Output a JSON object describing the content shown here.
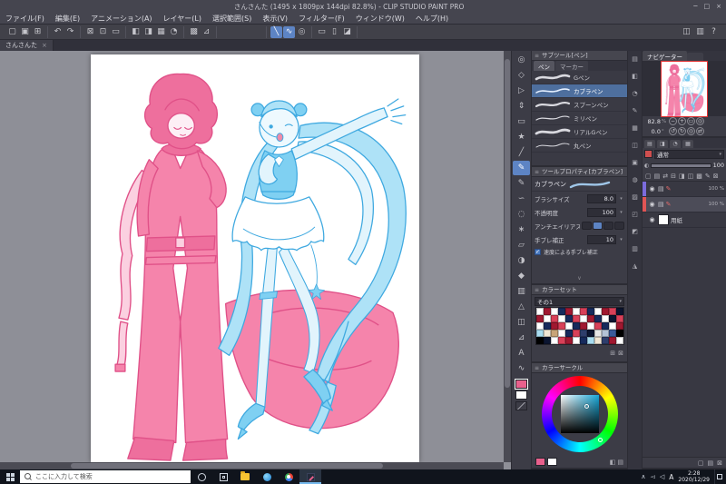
{
  "titlebar": {
    "title": "さんさんた (1495 x 1809px 144dpi 82.8%) - CLIP STUDIO PAINT PRO",
    "controls": [
      "─",
      "□",
      "×"
    ]
  },
  "icons": {
    "check": "✓",
    "caret_down": "▾",
    "close": "×",
    "menu": "≡",
    "collapse": "∨",
    "eye": "◉",
    "folder": "▤",
    "pen": "✎"
  },
  "menubar": {
    "items": [
      "ファイル(F)",
      "編集(E)",
      "アニメーション(A)",
      "レイヤー(L)",
      "選択範囲(S)",
      "表示(V)",
      "フィルター(F)",
      "ウィンドウ(W)",
      "ヘルプ(H)"
    ]
  },
  "toolbar": {
    "groups": [
      {
        "icons": [
          {
            "name": "new-file-icon",
            "glyph": "▢"
          },
          {
            "name": "open-file-icon",
            "glyph": "▣"
          },
          {
            "name": "save-file-icon",
            "glyph": "⊞"
          }
        ]
      },
      {
        "icons": [
          {
            "name": "undo-icon",
            "glyph": "↶"
          },
          {
            "name": "redo-icon",
            "glyph": "↷"
          }
        ]
      },
      {
        "icons": [
          {
            "name": "cut-icon",
            "glyph": "⊠"
          },
          {
            "name": "copy-icon",
            "glyph": "⊡"
          },
          {
            "name": "paste-icon",
            "glyph": "▭"
          }
        ]
      },
      {
        "icons": [
          {
            "name": "zoom-in-icon",
            "glyph": "◧"
          },
          {
            "name": "zoom-out-icon",
            "glyph": "◨"
          },
          {
            "name": "fit-to-screen-icon",
            "glyph": "▦"
          },
          {
            "name": "rotate-view-icon",
            "glyph": "◔"
          }
        ]
      },
      {
        "icons": [
          {
            "name": "grid-icon",
            "glyph": "▩"
          },
          {
            "name": "ruler-toggle-icon",
            "glyph": "⊿"
          }
        ]
      },
      {
        "icons": [
          {
            "name": "snap-to-ruler-icon",
            "glyph": "╲",
            "selected": true
          },
          {
            "name": "snap-to-special-ruler-icon",
            "glyph": "∿",
            "selected": true
          },
          {
            "name": "snap-to-grid-icon",
            "glyph": "◎"
          }
        ]
      },
      {
        "icons": [
          {
            "name": "select-area-icon",
            "glyph": "▭"
          },
          {
            "name": "deselect-icon",
            "glyph": "▯"
          },
          {
            "name": "invert-selection-icon",
            "glyph": "◪"
          }
        ]
      }
    ],
    "right_icons": [
      {
        "name": "workspace-icon",
        "glyph": "◫"
      },
      {
        "name": "palette-dock-toggle-icon",
        "glyph": "▥"
      },
      {
        "name": "help-icon",
        "glyph": "?"
      }
    ]
  },
  "canvas_tab": {
    "label": "さんさんた"
  },
  "tool_strip": {
    "tools": [
      {
        "name": "zoom-tool",
        "glyph": "◎"
      },
      {
        "name": "move-canvas-tool",
        "glyph": "◇"
      },
      {
        "name": "operation-tool",
        "glyph": "▷"
      },
      {
        "name": "layer-move-tool",
        "glyph": "⇕"
      },
      {
        "name": "selection-tool",
        "glyph": "▭"
      },
      {
        "name": "auto-select-tool",
        "glyph": "★"
      },
      {
        "name": "eyedropper-tool",
        "glyph": "╱"
      },
      {
        "name": "pen-tool",
        "glyph": "✎",
        "selected": true
      },
      {
        "name": "pencil-tool",
        "glyph": "✎"
      },
      {
        "name": "brush-tool",
        "glyph": "∽"
      },
      {
        "name": "airbrush-tool",
        "glyph": "◌"
      },
      {
        "name": "decoration-tool",
        "glyph": "∗"
      },
      {
        "name": "eraser-tool",
        "glyph": "▱"
      },
      {
        "name": "blend-tool",
        "glyph": "◑"
      },
      {
        "name": "fill-tool",
        "glyph": "◆"
      },
      {
        "name": "gradient-tool",
        "glyph": "▥"
      },
      {
        "name": "figure-tool",
        "glyph": "△"
      },
      {
        "name": "frame-border-tool",
        "glyph": "◫"
      },
      {
        "name": "ruler-tool",
        "glyph": "⊿"
      },
      {
        "name": "text-tool",
        "glyph": "A"
      },
      {
        "name": "line-correction-tool",
        "glyph": "∿"
      }
    ],
    "main_color": "#e8608c",
    "sub_color": "#ffffff"
  },
  "subtool": {
    "title": "サブツール[ペン]",
    "tabs": [
      {
        "label": "ペン",
        "active": true
      },
      {
        "label": "マーカー",
        "active": false
      }
    ],
    "brushes": [
      {
        "name": "Gペン",
        "w": 2.6
      },
      {
        "name": "カブラペン",
        "w": 1.6,
        "selected": true
      },
      {
        "name": "スプーンペン",
        "w": 2.2
      },
      {
        "name": "ミリペン",
        "w": 1.2
      },
      {
        "name": "リアルGペン",
        "w": 2.8
      },
      {
        "name": "丸ペン",
        "w": 1.0
      }
    ]
  },
  "tool_property": {
    "title": "ツールプロパティ[カブラペン]",
    "brush_name": "カブラペン",
    "rows": [
      {
        "label": "ブラシサイズ",
        "value": "8.0"
      },
      {
        "label": "不透明度",
        "value": "100"
      },
      {
        "label": "アンチエイリアス",
        "value": ""
      },
      {
        "label": "手ブレ補正",
        "value": "10"
      }
    ],
    "checkbox_label": "速度による手ブレ補正",
    "checkbox_checked": true
  },
  "color_set": {
    "title": "カラーセット",
    "dropdown": "その1",
    "palette": [
      "#ffffff",
      "#a01830",
      "#ffffff",
      "#162a5c",
      "#a01830",
      "#ffffff",
      "#d84058",
      "#162a5c",
      "#ffffff",
      "#a01830",
      "#d84058",
      "#0b1530",
      "#a01830",
      "#ffffff",
      "#d84058",
      "#ffffff",
      "#162a5c",
      "#d84058",
      "#ffffff",
      "#a01830",
      "#162a5c",
      "#ffffff",
      "#0b1530",
      "#d84058",
      "#ffffff",
      "#162a5c",
      "#a01830",
      "#d84058",
      "#ffffff",
      "#162a5c",
      "#a01830",
      "#ffffff",
      "#d84058",
      "#162a5c",
      "#ffffff",
      "#a01830",
      "#a8dcf0",
      "#f0e6d4",
      "#c8a478",
      "#ffffff",
      "#162a5c",
      "#d84058",
      "#2e3e6c",
      "#0b1530",
      "#e6e6e6",
      "#b4c2d6",
      "#3a5a9a",
      "#000000",
      "#000000",
      "#0b1530",
      "#ffffff",
      "#d84058",
      "#a01830",
      "#ffffff",
      "#162a5c",
      "#a8dcf0",
      "#f0e6d4",
      "#2e3e6c",
      "#a01830",
      "#ffffff"
    ]
  },
  "color_circle": {
    "title": "カラーサークル",
    "current_hue": "#18a8d8",
    "chips": [
      "#e8608c",
      "#ffffff"
    ]
  },
  "dock_strip": [
    {
      "name": "dock-quick-access-icon",
      "glyph": "▤"
    },
    {
      "name": "dock-material-icon",
      "glyph": "◧"
    },
    {
      "name": "dock-history-icon",
      "glyph": "◔"
    },
    {
      "name": "dock-brush-icon",
      "glyph": "✎"
    },
    {
      "name": "dock-pattern-icon",
      "glyph": "▦"
    },
    {
      "name": "dock-frame-icon",
      "glyph": "◫"
    },
    {
      "name": "dock-image-icon",
      "glyph": "▣"
    },
    {
      "name": "dock-tone-icon",
      "glyph": "◍"
    },
    {
      "name": "dock-hatch-icon",
      "glyph": "▨"
    },
    {
      "name": "dock-layout-icon",
      "glyph": "◰"
    },
    {
      "name": "dock-corner-icon",
      "glyph": "◩"
    },
    {
      "name": "dock-lines-icon",
      "glyph": "▥"
    },
    {
      "name": "dock-shape-icon",
      "glyph": "◮"
    }
  ],
  "navigator": {
    "title": "ナビゲーター",
    "button_rows": [
      {
        "value": "82.8",
        "unit": "%",
        "buttons": [
          {
            "name": "zoom-out-button",
            "glyph": "−"
          },
          {
            "name": "zoom-in-button",
            "glyph": "+"
          },
          {
            "name": "fit-to-window-button",
            "glyph": "▭"
          },
          {
            "name": "actual-size-button",
            "glyph": "◎"
          }
        ]
      },
      {
        "value": "0.0",
        "unit": "°",
        "buttons": [
          {
            "name": "rotate-left-button",
            "glyph": "↺"
          },
          {
            "name": "rotate-right-button",
            "glyph": "↻"
          },
          {
            "name": "reset-rotation-button",
            "glyph": "◎"
          },
          {
            "name": "flip-horizontal-button",
            "glyph": "⇄"
          }
        ]
      }
    ]
  },
  "layers": {
    "palette_tabs": [
      {
        "name": "layer-palette-tab",
        "glyph": "▤"
      },
      {
        "name": "layer-property-tab",
        "glyph": "◨"
      },
      {
        "name": "search-layer-tab",
        "glyph": "◔"
      },
      {
        "name": "animation-cels-tab",
        "glyph": "▦"
      }
    ],
    "blend_mode": "通常",
    "blend_swatch": "#cf4f4f",
    "opacity_value": "100",
    "command_icons": [
      {
        "name": "new-layer-icon",
        "glyph": "▢"
      },
      {
        "name": "new-folder-icon",
        "glyph": "▤"
      },
      {
        "name": "transfer-layer-icon",
        "glyph": "⇄"
      },
      {
        "name": "combine-layer-icon",
        "glyph": "⊟"
      },
      {
        "name": "clip-at-layer-icon",
        "glyph": "◨"
      },
      {
        "name": "lock-layer-icon",
        "glyph": "◫"
      },
      {
        "name": "lock-alpha-icon",
        "glyph": "▩"
      },
      {
        "name": "set-as-draft-icon",
        "glyph": "✎"
      },
      {
        "name": "delete-layer-icon",
        "glyph": "⊠"
      }
    ],
    "rows": [
      {
        "type": "folder",
        "tag_color": "#7b6cdc",
        "opacity": "100 %",
        "selected": false
      },
      {
        "type": "folder",
        "tag_color": "#e05555",
        "opacity": "100 %",
        "selected": true
      },
      {
        "type": "paper",
        "name": "用紙"
      }
    ],
    "footer_icons": [
      {
        "name": "layer-footer-new-icon",
        "glyph": "▢"
      },
      {
        "name": "layer-footer-folder-icon",
        "glyph": "▤"
      },
      {
        "name": "layer-footer-delete-icon",
        "glyph": "⊠"
      }
    ]
  },
  "taskbar": {
    "search_placeholder": "ここに入力して検索",
    "apps": [
      {
        "name": "cortana-icon",
        "cls": "ic-cortana"
      },
      {
        "name": "task-view-icon",
        "cls": "ic-taskview"
      },
      {
        "name": "file-explorer-icon",
        "cls": "ic-explorer"
      },
      {
        "name": "edge-icon",
        "cls": "ic-edge"
      },
      {
        "name": "chrome-icon",
        "cls": "ic-chrome"
      },
      {
        "name": "clip-studio-taskbar-icon",
        "cls": "ic-csp",
        "active": true
      }
    ],
    "tray_icons": [
      {
        "name": "tray-expand-icon",
        "glyph": "∧"
      },
      {
        "name": "network-icon",
        "glyph": "◅"
      },
      {
        "name": "volume-icon",
        "glyph": "◁"
      }
    ],
    "ime": "A",
    "time": "2:28",
    "date": "2020/12/29"
  }
}
